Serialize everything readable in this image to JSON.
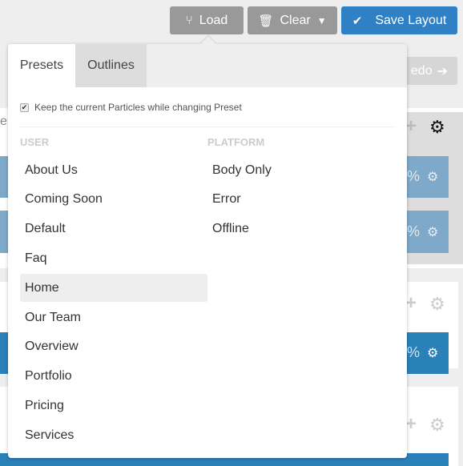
{
  "toolbar": {
    "load": "Load",
    "clear": "Clear",
    "save": "Save Layout",
    "redo": "edo"
  },
  "popover": {
    "tabs": [
      "Presets",
      "Outlines"
    ],
    "active_tab": "Presets",
    "keep_particles": {
      "label": "Keep the current Particles while changing Preset",
      "checked": true
    },
    "user_heading": "USER",
    "platform_heading": "PLATFORM",
    "user": [
      "About Us",
      "Coming Soon",
      "Default",
      "Faq",
      "Home",
      "Our Team",
      "Overview",
      "Portfolio",
      "Pricing",
      "Services"
    ],
    "platform": [
      "Body Only",
      "Error",
      "Offline"
    ],
    "selected": "Home"
  },
  "background": {
    "partial_label": "e",
    "percent": "%"
  },
  "colors": {
    "accent": "#2f80c4",
    "button_gray": "#999999"
  }
}
